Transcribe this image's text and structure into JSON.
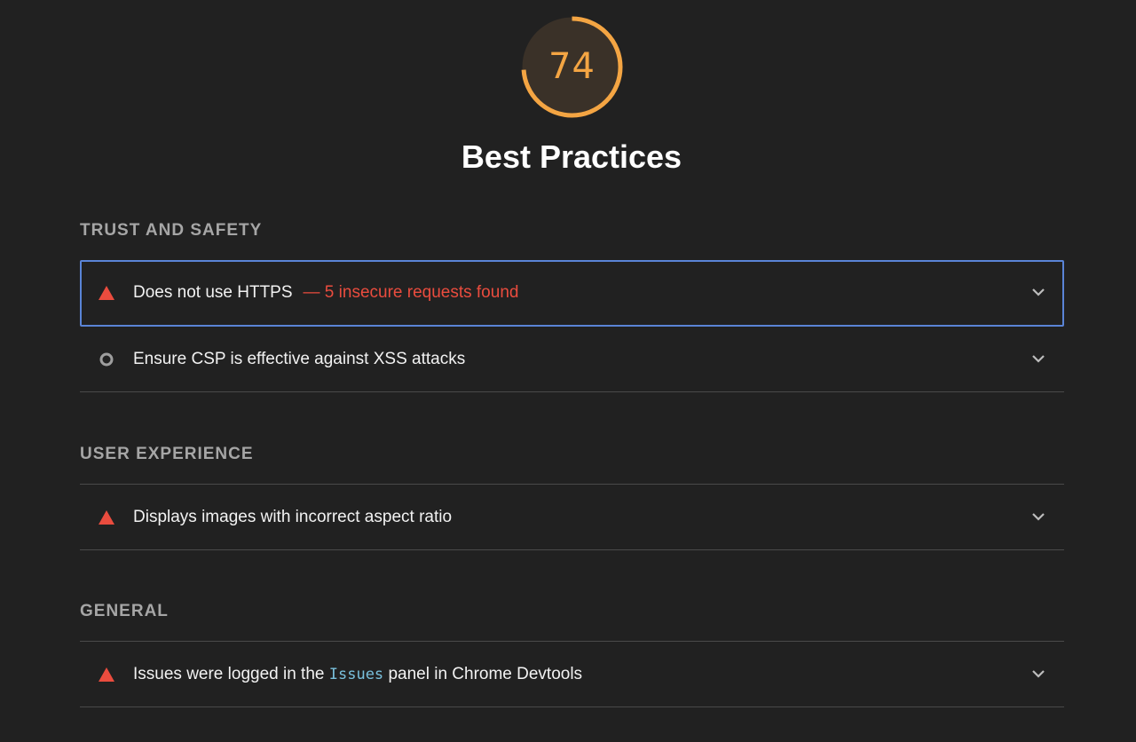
{
  "gauge": {
    "score": "74",
    "score_fraction": 0.74,
    "color": "#f4a543"
  },
  "category": {
    "title": "Best Practices"
  },
  "groups": [
    {
      "title": "TRUST AND SAFETY",
      "audits": [
        {
          "title": "Does not use HTTPS",
          "display_value": "— 5 insecure requests found",
          "status": "fail",
          "icon": "warning-triangle-icon",
          "focused": true
        },
        {
          "title": "Ensure CSP is effective against XSS attacks",
          "status": "informative",
          "icon": "circle-outline-icon"
        }
      ]
    },
    {
      "title": "USER EXPERIENCE",
      "audits": [
        {
          "title": "Displays images with incorrect aspect ratio",
          "status": "fail",
          "icon": "warning-triangle-icon"
        }
      ]
    },
    {
      "title": "GENERAL",
      "audits": [
        {
          "title_before": "Issues were logged in the ",
          "title_code": "Issues",
          "title_after": " panel in Chrome Devtools",
          "status": "fail",
          "icon": "warning-triangle-icon"
        }
      ]
    }
  ],
  "colors": {
    "background": "#212121",
    "fail": "#ea4c3e",
    "focus_border": "#5a84d6",
    "code": "#79c0dc",
    "group_title": "#a6a6a6"
  }
}
